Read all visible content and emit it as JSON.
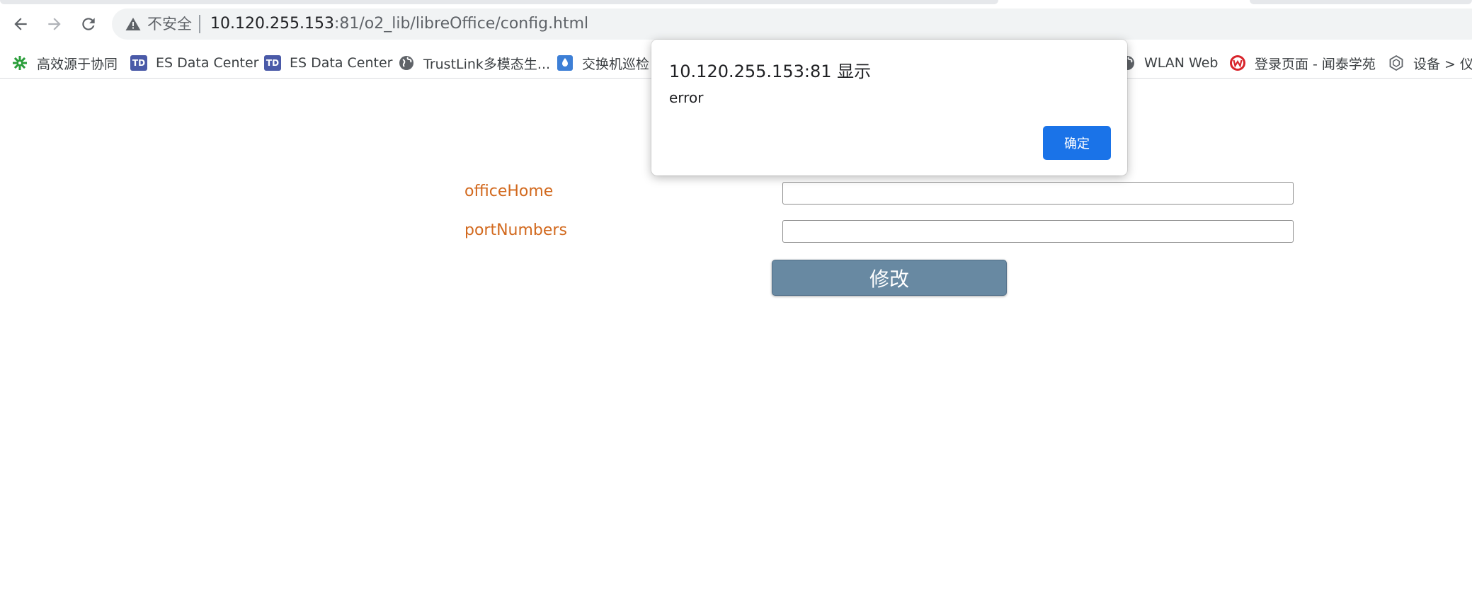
{
  "browser": {
    "security_label": "不安全",
    "url_host": "10.120.255.153",
    "url_rest": ":81/o2_lib/libreOffice/config.html",
    "bookmarks": [
      {
        "label": "高效源于协同",
        "icon": "green-gear-icon"
      },
      {
        "label": "ES Data Center",
        "icon": "td-icon"
      },
      {
        "label": "ES Data Center",
        "icon": "td-icon"
      },
      {
        "label": "TrustLink多模态生...",
        "icon": "globe-icon"
      },
      {
        "label": "交换机巡检",
        "icon": "blue-drop-icon"
      },
      {
        "label": "WLAN Web",
        "icon": "globe-icon"
      },
      {
        "label": "登录页面 - 闻泰学苑",
        "icon": "red-w-icon"
      },
      {
        "label": "设备 > 仪",
        "icon": "hexagon-icon"
      }
    ]
  },
  "form": {
    "office_home_label": "officeHome",
    "office_home_value": "",
    "port_numbers_label": "portNumbers",
    "port_numbers_value": "",
    "submit_label": "修改"
  },
  "dialog": {
    "title": "10.120.255.153:81 显示",
    "message": "error",
    "ok_label": "确定"
  },
  "colors": {
    "label_color": "#d2691e",
    "submit_bg": "#6889a2",
    "ok_bg": "#1a73e8"
  }
}
